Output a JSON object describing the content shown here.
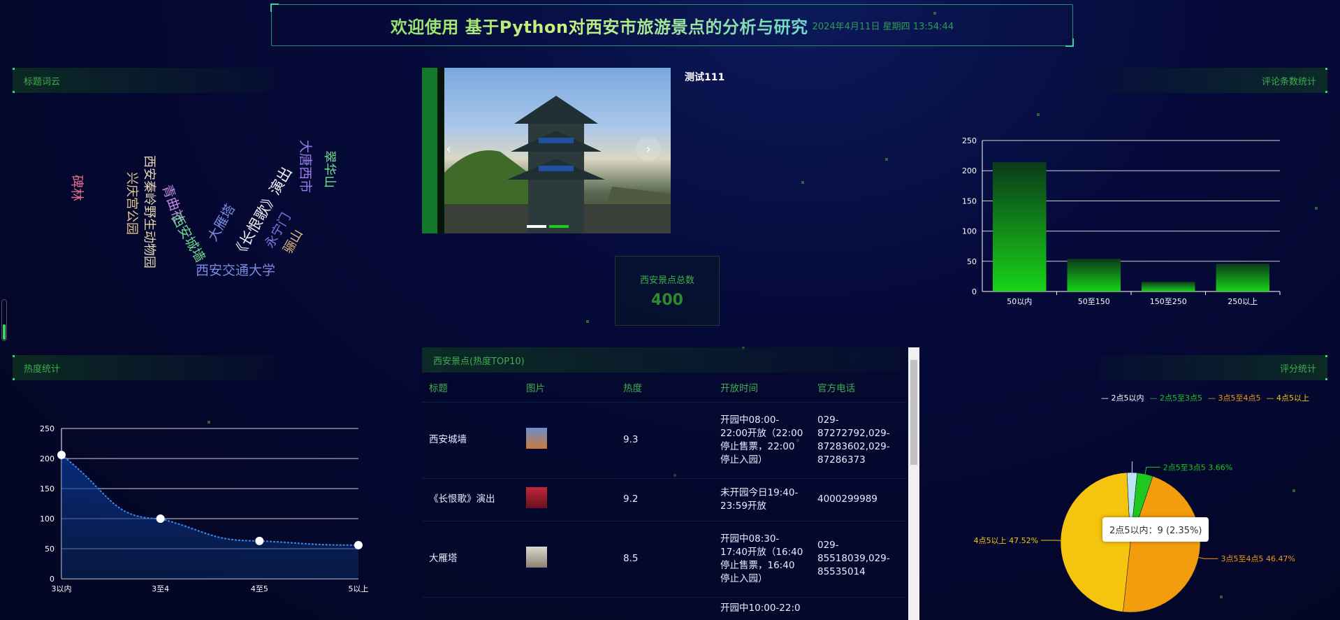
{
  "header": {
    "title": "欢迎使用 基于Python对西安市旅游景点的分析与研究",
    "datetime": "2024年4月11日 星期四 13:54:44"
  },
  "panels": {
    "wordcloud_title": "标题词云",
    "comments_title": "评论条数统计",
    "heat_title": "热度统计",
    "rating_title": "评分统计",
    "table_title": "西安景点(热度TOP10)"
  },
  "wordcloud": {
    "words": [
      {
        "text": "碑林",
        "color": "#e06a8a"
      },
      {
        "text": "兴庆宫公园",
        "color": "#e3c88a"
      },
      {
        "text": "西安秦岭野生动物园",
        "color": "#e7d6b0"
      },
      {
        "text": "青曲社",
        "color": "#c08ae0"
      },
      {
        "text": "西安城墙",
        "color": "#6fd68a"
      },
      {
        "text": "大雁塔",
        "color": "#7a8ae0"
      },
      {
        "text": "《长恨歌》演出",
        "color": "#f0f0f0"
      },
      {
        "text": "永宁门",
        "color": "#7a7ae8"
      },
      {
        "text": "骊山",
        "color": "#e0c07a"
      },
      {
        "text": "大唐西市",
        "color": "#9a7ae8"
      },
      {
        "text": "翠华山",
        "color": "#6fe08a"
      },
      {
        "text": "西安交通大学",
        "color": "#7a8ae0"
      }
    ]
  },
  "carousel": {
    "caption": "测试111",
    "prev_icon": "chevron-left-icon",
    "next_icon": "chevron-right-icon"
  },
  "total": {
    "label": "西安景点总数",
    "value": "400"
  },
  "table": {
    "headers": [
      "标题",
      "图片",
      "热度",
      "开放时间",
      "官方电话"
    ],
    "rows": [
      {
        "title": "西安城墙",
        "heat": "9.3",
        "open": "开园中08:00-22:00开放（22:00停止售票，22:00停止入园）",
        "phone": "029-87272792,029-87283602,029-87286373",
        "thumb": "#c97a3a"
      },
      {
        "title": "《长恨歌》演出",
        "heat": "9.2",
        "open": "未开园今日19:40-23:59开放",
        "phone": "4000299989",
        "thumb": "#c0283a"
      },
      {
        "title": "大雁塔",
        "heat": "8.5",
        "open": "开园中08:30-17:40开放（16:40停止售票，16:40停止入园）",
        "phone": "029-85518039,029-85535014",
        "thumb": "#b7b0a0"
      },
      {
        "title": "",
        "heat": "",
        "open": "开园中10:00-22:0",
        "phone": "",
        "thumb": ""
      }
    ]
  },
  "chart_data": [
    {
      "type": "bar",
      "title": "评论条数统计",
      "categories": [
        "50以内",
        "50至150",
        "150至250",
        "250以上"
      ],
      "values": [
        214,
        54,
        16,
        46
      ],
      "ylim": [
        0,
        250
      ],
      "yticks": [
        0,
        50,
        100,
        150,
        200,
        250
      ],
      "grid": true
    },
    {
      "type": "line",
      "title": "热度统计",
      "categories": [
        "3以内",
        "3至4",
        "4至5",
        "5以上"
      ],
      "values": [
        206,
        100,
        63,
        56
      ],
      "ylim": [
        0,
        250
      ],
      "yticks": [
        0,
        50,
        100,
        150,
        200,
        250
      ],
      "grid": true
    },
    {
      "type": "pie",
      "title": "评分统计",
      "slices": [
        {
          "name": "2点5以内",
          "value": 9,
          "percent": "2.35%",
          "color": "#b9e6f0"
        },
        {
          "name": "2点5至3点5",
          "value": 14,
          "percent": "3.66%",
          "color": "#1ec81e"
        },
        {
          "name": "3点5至4点5",
          "value": 178,
          "percent": "46.47%",
          "color": "#f39c0e"
        },
        {
          "name": "4点5以上",
          "value": 182,
          "percent": "47.52%",
          "color": "#f5c40e"
        }
      ],
      "legend_position": "top-right",
      "tooltip": "2点5以内：9 (2.35%)"
    }
  ]
}
